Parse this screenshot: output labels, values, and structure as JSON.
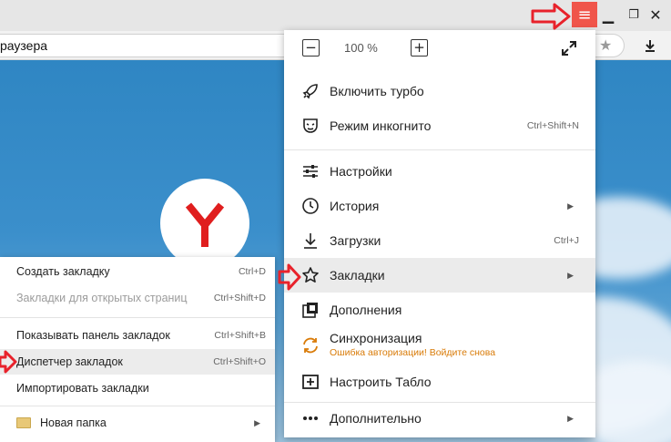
{
  "browser": {
    "address_text": "раузера"
  },
  "main_menu": {
    "zoom": {
      "minus": "−",
      "value": "100 %",
      "plus": "+"
    },
    "items": [
      {
        "label": "Включить турбо",
        "shortcut": "",
        "icon": "rocket-icon"
      },
      {
        "label": "Режим инкогнито",
        "shortcut": "Ctrl+Shift+N",
        "icon": "incognito-mask-icon"
      },
      {
        "label": "Настройки",
        "shortcut": "",
        "icon": "settings-sliders-icon"
      },
      {
        "label": "История",
        "shortcut": "",
        "icon": "clock-icon",
        "submenu": true
      },
      {
        "label": "Загрузки",
        "shortcut": "Ctrl+J",
        "icon": "download-icon"
      },
      {
        "label": "Закладки",
        "shortcut": "",
        "icon": "star-icon",
        "submenu": true,
        "highlighted": true
      },
      {
        "label": "Дополнения",
        "shortcut": "",
        "icon": "extensions-icon"
      },
      {
        "label": "Синхронизация",
        "status": "Ошибка авторизации! Войдите снова",
        "icon": "sync-icon"
      },
      {
        "label": "Настроить Табло",
        "shortcut": "",
        "icon": "add-tile-icon"
      },
      {
        "label": "Дополнительно",
        "shortcut": "",
        "icon": "more-dots-icon",
        "submenu": true
      }
    ]
  },
  "bookmarks_menu": {
    "items": [
      {
        "label": "Создать закладку",
        "shortcut": "Ctrl+D"
      },
      {
        "label": "Закладки для открытых страниц",
        "shortcut": "Ctrl+Shift+D",
        "disabled": true
      },
      {
        "label": "Показывать панель закладок",
        "shortcut": "Ctrl+Shift+B"
      },
      {
        "label": "Диспетчер закладок",
        "shortcut": "Ctrl+Shift+O",
        "highlighted": true
      },
      {
        "label": "Импортировать закладки",
        "shortcut": ""
      },
      {
        "label": "Новая папка",
        "shortcut": "",
        "icon": "folder-icon",
        "submenu": true
      }
    ]
  },
  "colors": {
    "accent_red": "#f0554a",
    "pointer_arrow": "#e8222b",
    "sync_error": "#d97b08",
    "menu_hover": "#ebebeb"
  }
}
